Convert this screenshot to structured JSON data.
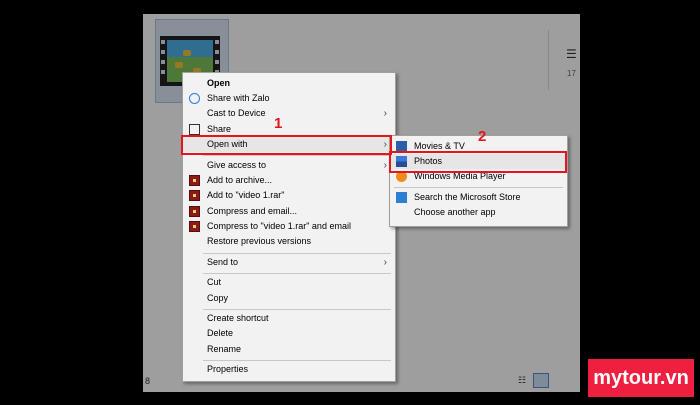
{
  "explorer": {
    "right_count": "17",
    "status_count": "8"
  },
  "context_menu": {
    "items": [
      {
        "label": "Open",
        "icon": "none"
      },
      {
        "label": "Share with Zalo",
        "icon": "zalo-icon"
      },
      {
        "label": "Cast to Device",
        "icon": "none",
        "submenu": true
      },
      {
        "label": "Share",
        "icon": "share-icon"
      },
      {
        "label": "Open with",
        "icon": "none",
        "submenu": true,
        "highlighted": true
      },
      {
        "label": "Give access to",
        "icon": "none",
        "submenu": true
      },
      {
        "label": "Add to archive...",
        "icon": "winrar-icon"
      },
      {
        "label": "Add to \"video 1.rar\"",
        "icon": "winrar-icon"
      },
      {
        "label": "Compress and email...",
        "icon": "winrar-icon"
      },
      {
        "label": "Compress to \"video 1.rar\" and email",
        "icon": "winrar-icon"
      },
      {
        "label": "Restore previous versions",
        "icon": "none"
      },
      {
        "label": "Send to",
        "icon": "none",
        "submenu": true
      },
      {
        "label": "Cut",
        "icon": "none"
      },
      {
        "label": "Copy",
        "icon": "none"
      },
      {
        "label": "Create shortcut",
        "icon": "none"
      },
      {
        "label": "Delete",
        "icon": "none"
      },
      {
        "label": "Rename",
        "icon": "none"
      },
      {
        "label": "Properties",
        "icon": "none"
      }
    ]
  },
  "open_with_submenu": {
    "items": [
      {
        "label": "Movies & TV",
        "icon": "movies-tv-icon"
      },
      {
        "label": "Photos",
        "icon": "photos-icon",
        "highlighted": true
      },
      {
        "label": "Windows Media Player",
        "icon": "media-player-icon"
      },
      {
        "label": "Search the Microsoft Store",
        "icon": "store-icon"
      },
      {
        "label": "Choose another app",
        "icon": "none"
      }
    ]
  },
  "annotations": {
    "step1": "1",
    "step2": "2"
  },
  "brand": {
    "text": "mytour.vn"
  },
  "colors": {
    "annotation_red": "#e8141c",
    "brand_red": "#ef1f3f"
  }
}
